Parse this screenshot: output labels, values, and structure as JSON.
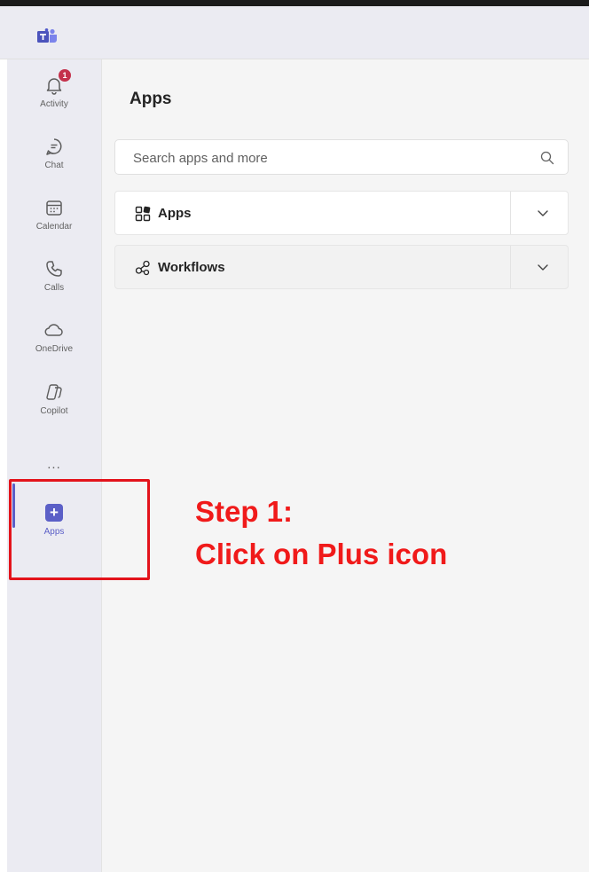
{
  "rail": {
    "items": [
      {
        "id": "activity",
        "label": "Activity",
        "badge": "1"
      },
      {
        "id": "chat",
        "label": "Chat"
      },
      {
        "id": "calendar",
        "label": "Calendar"
      },
      {
        "id": "calls",
        "label": "Calls"
      },
      {
        "id": "onedrive",
        "label": "OneDrive"
      },
      {
        "id": "copilot",
        "label": "Copilot"
      }
    ],
    "more": "...",
    "apps": {
      "label": "Apps",
      "icon": "+"
    }
  },
  "main": {
    "title": "Apps",
    "search": {
      "placeholder": "Search apps and more"
    },
    "sections": [
      {
        "label": "Apps"
      },
      {
        "label": "Workflows"
      }
    ]
  },
  "annotation": {
    "line1": "Step 1:",
    "line2": "Click on Plus icon",
    "color": "#f01a1a"
  },
  "colors": {
    "accent": "#5b5fc7",
    "badge": "#c4314b",
    "rail_bg": "#ebebf2",
    "main_bg": "#f5f5f5"
  }
}
